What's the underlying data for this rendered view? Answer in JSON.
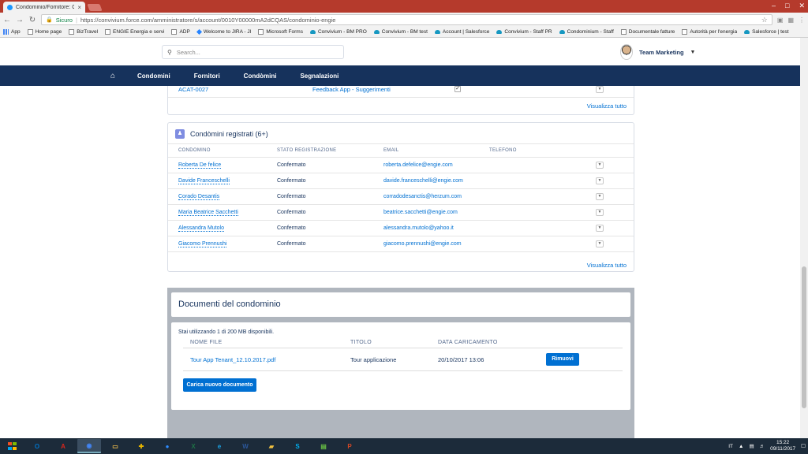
{
  "browser": {
    "tab_title": "Condominio/Fornitore: C",
    "tab_close": "×",
    "secure_label": "Sicuro",
    "url": "https://convivium.force.com/amministratore/s/account/0010Y00000mA2dCQAS/condominio-engie",
    "bookmarks": [
      {
        "label": "App",
        "icon": "grid"
      },
      {
        "label": "Home page",
        "icon": "page"
      },
      {
        "label": "BizTravel",
        "icon": "page"
      },
      {
        "label": "ENGIE Energia e servi",
        "icon": "page"
      },
      {
        "label": "ADP",
        "icon": "page"
      },
      {
        "label": "Welcome to JIRA - JI",
        "icon": "jira"
      },
      {
        "label": "Microsoft Forms",
        "icon": "page"
      },
      {
        "label": "Convivium - BM PRO",
        "icon": "cloud"
      },
      {
        "label": "Convivium - BM test",
        "icon": "cloud"
      },
      {
        "label": "Account | Salesforce",
        "icon": "cloud"
      },
      {
        "label": "Convivium - Staff PR",
        "icon": "cloud"
      },
      {
        "label": "Condominium - Staff",
        "icon": "cloud"
      },
      {
        "label": "Documentale fatture",
        "icon": "page"
      },
      {
        "label": "Autorità per l'energia",
        "icon": "page"
      },
      {
        "label": "Salesforce | test",
        "icon": "cloud"
      }
    ]
  },
  "header": {
    "search_placeholder": "Search...",
    "user_name": "Team Marketing"
  },
  "nav": {
    "items": [
      "Condomini",
      "Fornitori",
      "Condòmini",
      "Segnalazioni"
    ]
  },
  "card_prev": {
    "code": "ACAT-0027",
    "category": "Feedback App - Suggerimenti",
    "checked": "✓",
    "view_all": "Visualizza tutto"
  },
  "condomini_card": {
    "title": "Condòmini registrati (6+)",
    "headers": [
      "CONDOMINO",
      "STATO REGISTRAZIONE",
      "EMAIL",
      "TELEFONO"
    ],
    "rows": [
      {
        "name": "Roberta De felice",
        "status": "Confermato",
        "email": "roberta.defelice@engie.com",
        "phone": ""
      },
      {
        "name": "Davide Franceschelli",
        "status": "Confermato",
        "email": "davide.franceschelli@engie.com",
        "phone": ""
      },
      {
        "name": "Corado Desantis",
        "status": "Confermato",
        "email": "corradodesanctis@herzum.com",
        "phone": ""
      },
      {
        "name": "Maria Beatrice Sacchetti",
        "status": "Confermato",
        "email": "beatrice.sacchetti@engie.com",
        "phone": ""
      },
      {
        "name": "Alessandra Mutolo",
        "status": "Confermato",
        "email": "alessandra.mutolo@yahoo.it",
        "phone": ""
      },
      {
        "name": "Giacomo Prennushi",
        "status": "Confermato",
        "email": "giacomo.prennushi@engie.com",
        "phone": ""
      }
    ],
    "view_all": "Visualizza tutto"
  },
  "documents": {
    "title": "Documenti del condominio",
    "usage": "Stai utilizzando 1 di 200 MB disponibili.",
    "headers": [
      "NOME FILE",
      "TITOLO",
      "DATA CARICAMENTO"
    ],
    "rows": [
      {
        "file": "Tour App Tenant_12.10.2017.pdf",
        "title": "Tour applicazione",
        "date": "20/10/2017 13:06",
        "action": "Rimuovi"
      }
    ],
    "upload_label": "Carica nuovo documento"
  },
  "taskbar": {
    "apps": [
      {
        "name": "outlook",
        "glyph": "O",
        "color": "#0072c6"
      },
      {
        "name": "acrobat",
        "glyph": "A",
        "color": "#d9261c"
      },
      {
        "name": "chrome",
        "glyph": "◉",
        "color": "#4285f4"
      },
      {
        "name": "explorer",
        "glyph": "▭",
        "color": "#e8b64a"
      },
      {
        "name": "plus",
        "glyph": "✚",
        "color": "#e5b400"
      },
      {
        "name": "camera",
        "glyph": "●",
        "color": "#2d8cff"
      },
      {
        "name": "excel",
        "glyph": "X",
        "color": "#1e7145"
      },
      {
        "name": "ie",
        "glyph": "e",
        "color": "#1ba1e2"
      },
      {
        "name": "word",
        "glyph": "W",
        "color": "#2b579a"
      },
      {
        "name": "folder",
        "glyph": "▰",
        "color": "#f0c040"
      },
      {
        "name": "skype",
        "glyph": "S",
        "color": "#00aff0"
      },
      {
        "name": "generic",
        "glyph": "▤",
        "color": "#6b4"
      },
      {
        "name": "powerpoint",
        "glyph": "P",
        "color": "#d24726"
      }
    ],
    "lang": "IT",
    "time": "15:22",
    "date": "09/11/2017"
  }
}
